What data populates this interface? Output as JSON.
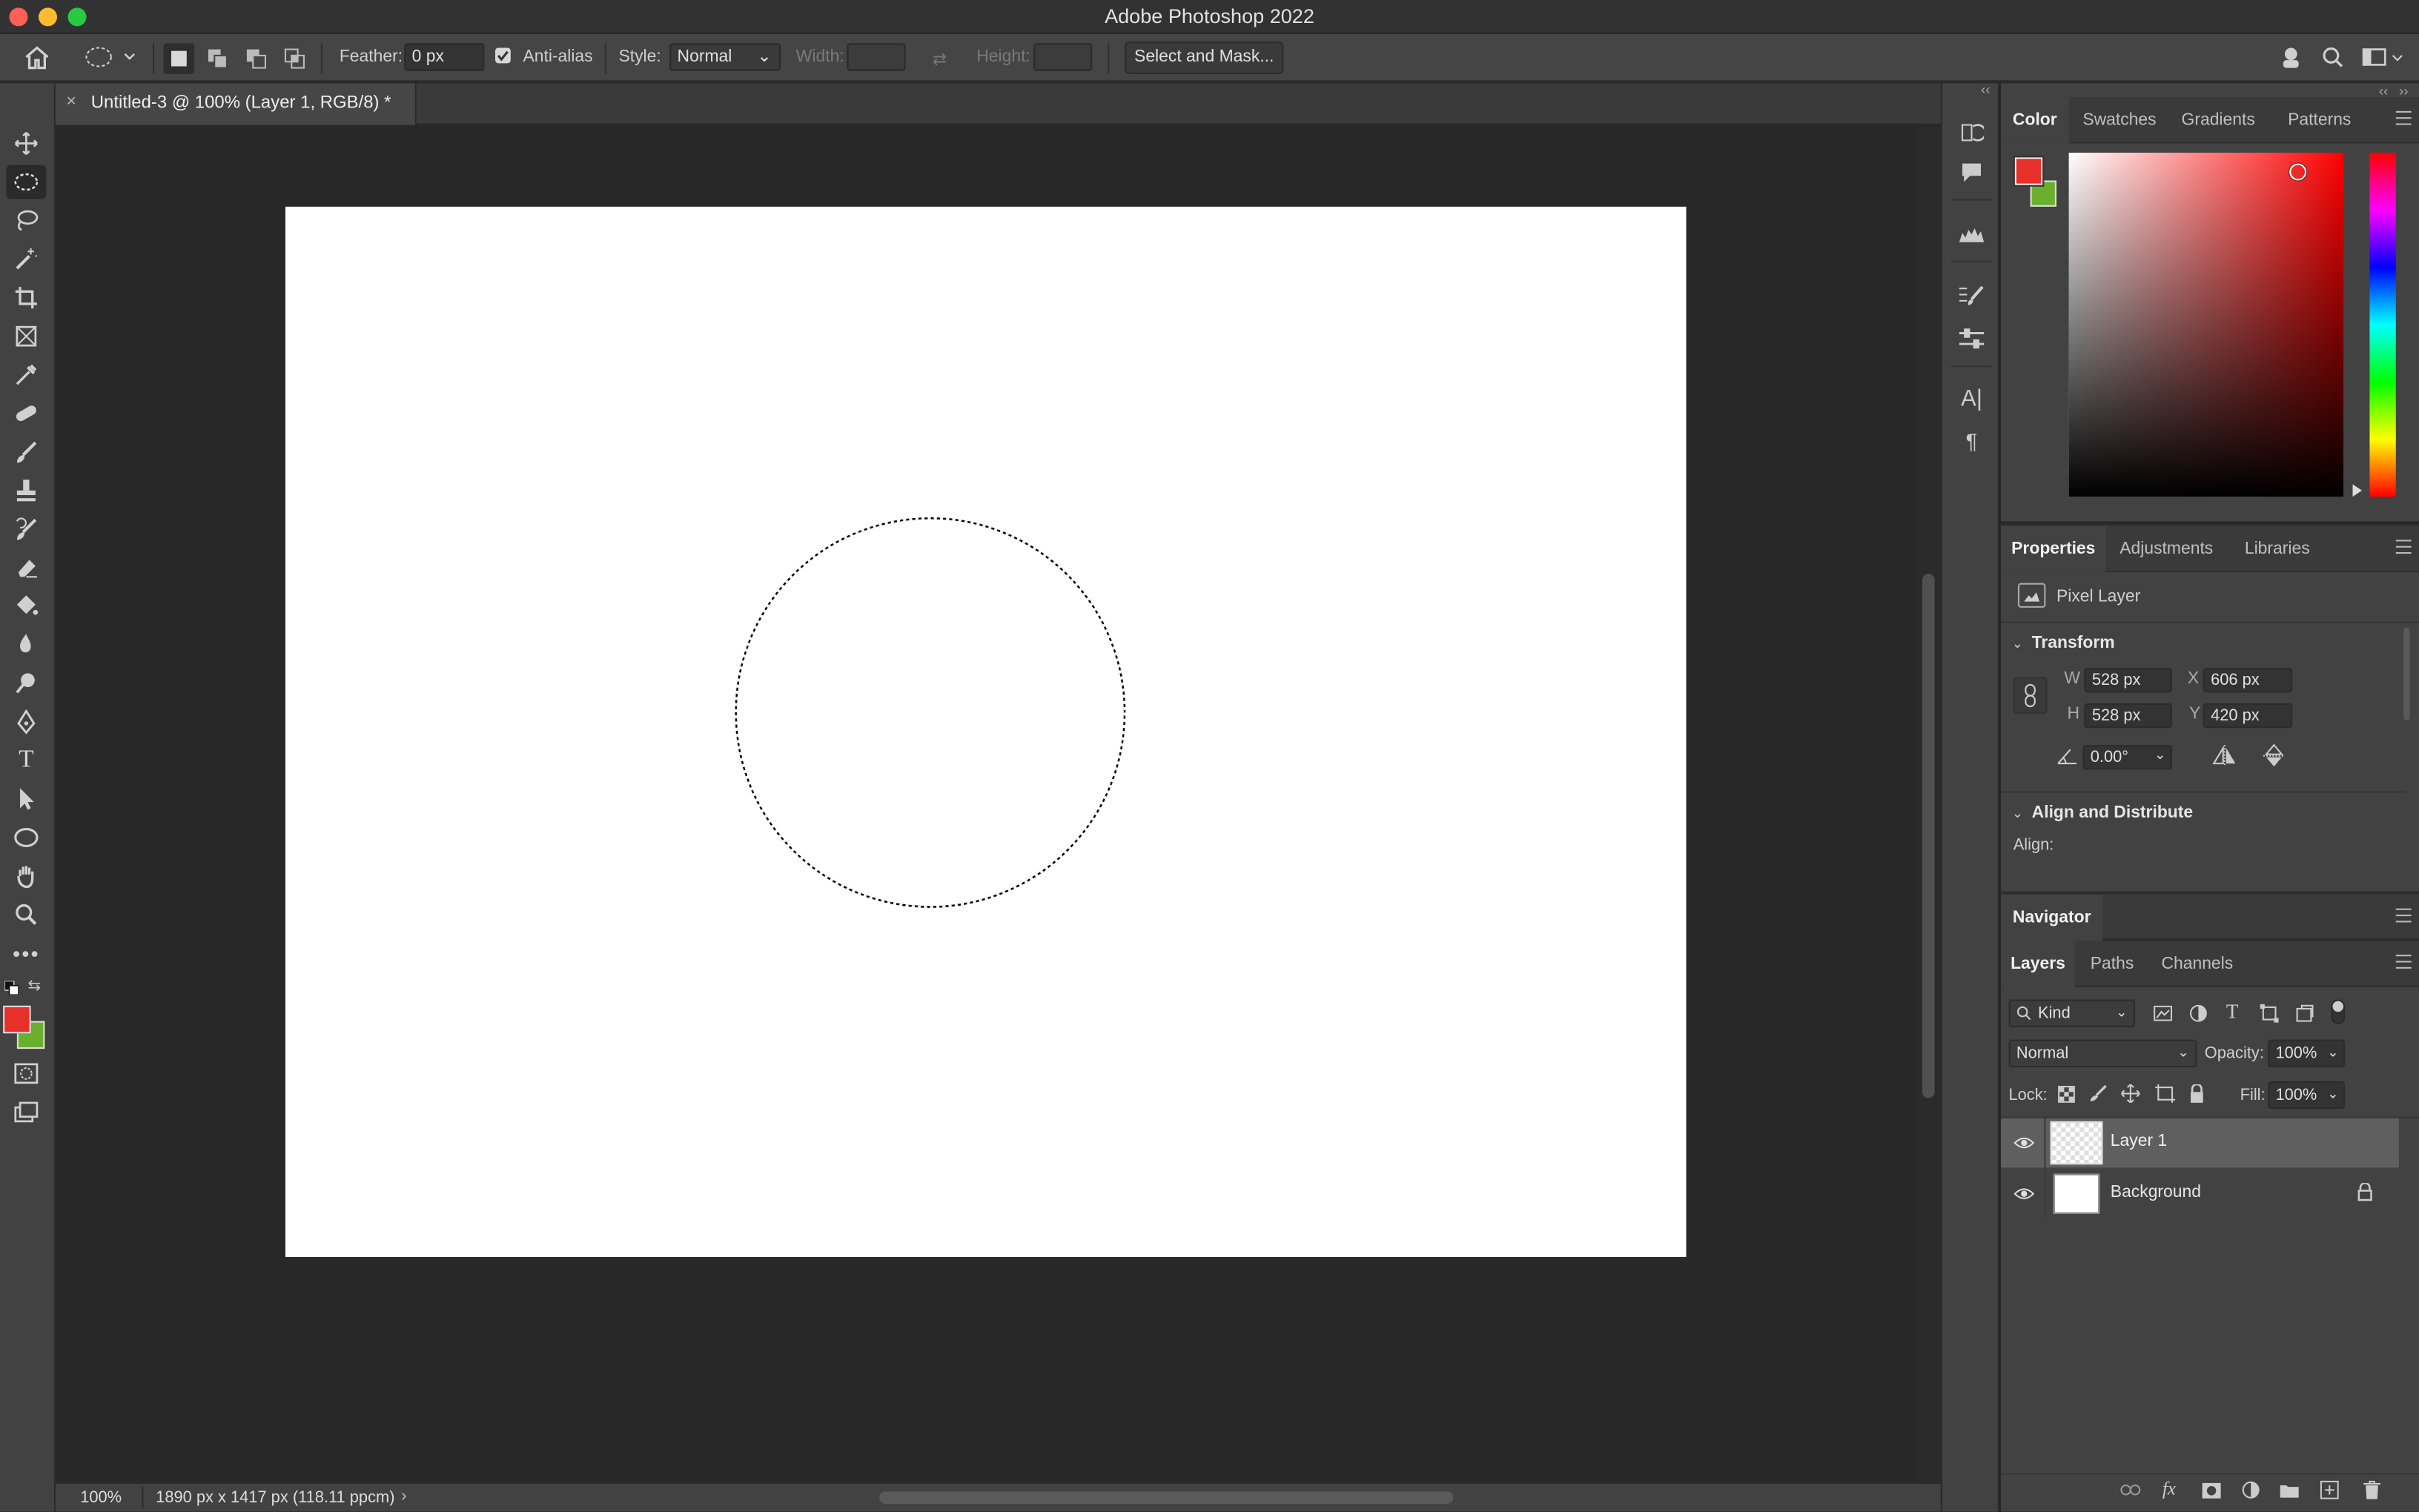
{
  "window": {
    "title": "Adobe Photoshop 2022"
  },
  "options": {
    "feather_label": "Feather:",
    "feather_value": "0 px",
    "antialias_label": "Anti-alias",
    "antialias_checked": true,
    "style_label": "Style:",
    "style_value": "Normal",
    "width_label": "Width:",
    "height_label": "Height:",
    "select_mask": "Select and Mask..."
  },
  "document": {
    "tab_title": "Untitled-3 @ 100% (Layer 1, RGB/8) *"
  },
  "status": {
    "zoom": "100%",
    "info": "1890 px x 1417 px (118.11 ppcm)"
  },
  "colors": {
    "foreground": "#e8302a",
    "background": "#6ab02e",
    "ui_bg": "#424242",
    "canvas_bg": "#282828"
  },
  "color_panel": {
    "tabs": [
      "Color",
      "Swatches",
      "Gradients",
      "Patterns"
    ]
  },
  "properties_panel": {
    "tabs": [
      "Properties",
      "Adjustments",
      "Libraries"
    ],
    "type": "Pixel Layer",
    "transform_title": "Transform",
    "w_label": "W",
    "w": "528 px",
    "h_label": "H",
    "h": "528 px",
    "x_label": "X",
    "x": "606 px",
    "y_label": "Y",
    "y": "420 px",
    "angle": "0.00°",
    "align_title": "Align and Distribute",
    "align_label": "Align:"
  },
  "navigator": {
    "title": "Navigator"
  },
  "layers_panel": {
    "tabs": [
      "Layers",
      "Paths",
      "Channels"
    ],
    "filter": "Kind",
    "blend_mode": "Normal",
    "opacity_label": "Opacity:",
    "opacity": "100%",
    "lock_label": "Lock:",
    "fill_label": "Fill:",
    "fill": "100%",
    "layers": [
      {
        "name": "Layer 1",
        "selected": true
      },
      {
        "name": "Background",
        "locked": true
      }
    ]
  }
}
